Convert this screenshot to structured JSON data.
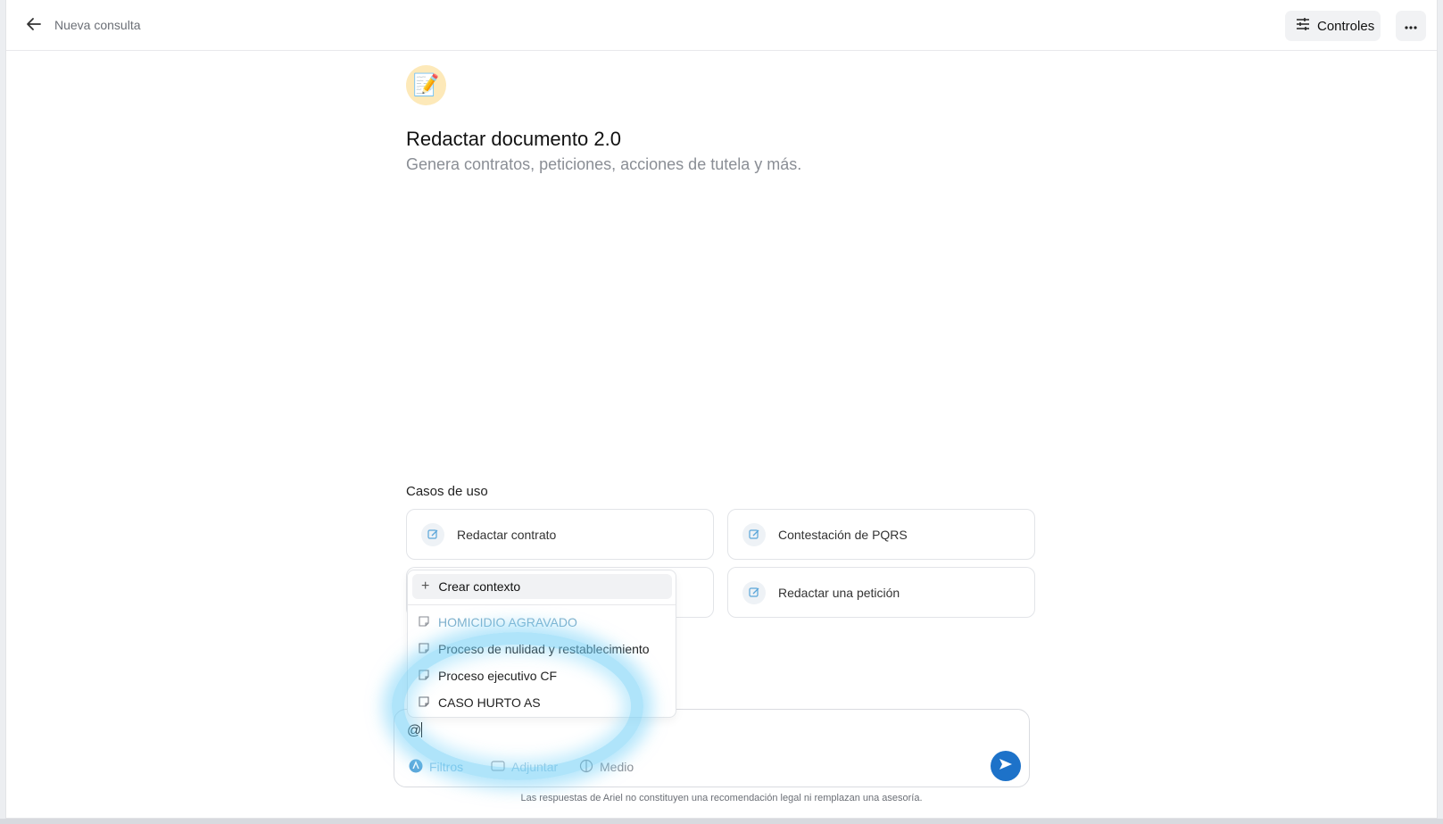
{
  "header": {
    "title": "Nueva consulta",
    "controls_label": "Controles"
  },
  "hero": {
    "emoji": "📝",
    "title": "Redactar documento 2.0",
    "subtitle": "Genera contratos, peticiones, acciones de tutela y más."
  },
  "use_cases": {
    "label": "Casos de uso",
    "items": [
      {
        "label": "Redactar contrato"
      },
      {
        "label": "Contestación de PQRS"
      },
      {
        "label": "Redactar una petición"
      }
    ]
  },
  "dropdown": {
    "create_label": "Crear contexto",
    "items": [
      {
        "label": "HOMICIDIO AGRAVADO"
      },
      {
        "label": "Proceso de nulidad y restablecimiento"
      },
      {
        "label": "Proceso ejecutivo CF"
      },
      {
        "label": "CASO HURTO AS"
      }
    ]
  },
  "composer": {
    "value": "@",
    "tools": [
      {
        "label": "Filtros"
      },
      {
        "label": "Adjuntar"
      },
      {
        "label": "Medio"
      }
    ]
  },
  "disclaimer": "Las respuestas de Ariel no constituyen una recomendación legal ni remplazan una asesoría.",
  "colors": {
    "accent": "#1d72c9",
    "highlight_ring": "#7dd3f6",
    "hero_icon_bg": "#fde9b9"
  }
}
